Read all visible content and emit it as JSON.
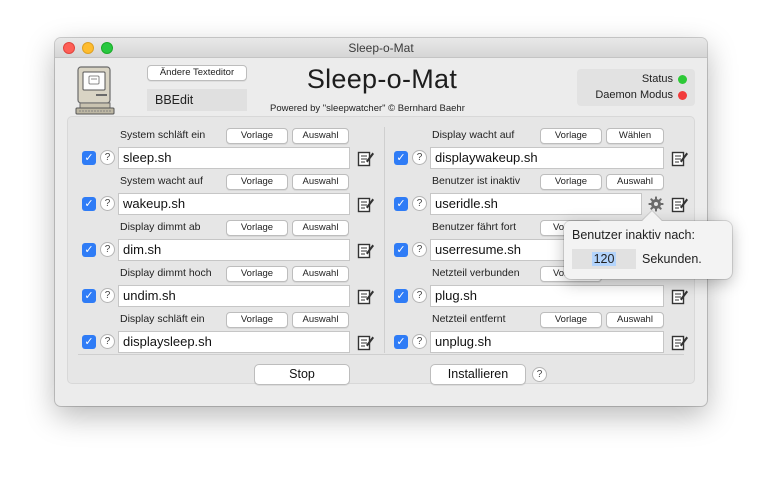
{
  "window": {
    "title": "Sleep-o-Mat"
  },
  "header": {
    "change_editor_label": "Ändere Texteditor",
    "editor_name": "BBEdit",
    "app_title": "Sleep-o-Mat",
    "subtitle": "Powered by \"sleepwatcher\" © Bernhard Baehr",
    "status_label": "Status",
    "status_color": "#2dc937",
    "daemon_label": "Daemon Modus",
    "daemon_color": "#f23b3b"
  },
  "rules_left": [
    {
      "label": "System schläft ein",
      "btn1": "Vorlage",
      "btn2": "Auswahl",
      "value": "sleep.sh",
      "checked": true
    },
    {
      "label": "System wacht auf",
      "btn1": "Vorlage",
      "btn2": "Auswahl",
      "value": "wakeup.sh",
      "checked": true
    },
    {
      "label": "Display dimmt ab",
      "btn1": "Vorlage",
      "btn2": "Auswahl",
      "value": "dim.sh",
      "checked": true
    },
    {
      "label": "Display dimmt hoch",
      "btn1": "Vorlage",
      "btn2": "Auswahl",
      "value": "undim.sh",
      "checked": true
    },
    {
      "label": "Display schläft ein",
      "btn1": "Vorlage",
      "btn2": "Auswahl",
      "value": "displaysleep.sh",
      "checked": true
    }
  ],
  "rules_right": [
    {
      "label": "Display wacht auf",
      "btn1": "Vorlage",
      "btn2": "Wählen",
      "value": "displaywakeup.sh",
      "checked": true
    },
    {
      "label": "Benutzer ist inaktiv",
      "btn1": "Vorlage",
      "btn2": "Auswahl",
      "value": "useridle.sh",
      "checked": true
    },
    {
      "label": "Benutzer fährt fort",
      "btn1": "Vor",
      "btn2": "",
      "value": "userresume.sh",
      "checked": true
    },
    {
      "label": "Netzteil verbunden",
      "btn1": "Vor",
      "btn2": "",
      "value": "plug.sh",
      "checked": true
    },
    {
      "label": "Netzteil entfernt",
      "btn1": "Vorlage",
      "btn2": "Auswahl",
      "value": "unplug.sh",
      "checked": true
    }
  ],
  "help_mark": "?",
  "check_mark": "✓",
  "footer": {
    "stop_label": "Stop",
    "install_label": "Installieren"
  },
  "popover": {
    "title": "Benutzer inaktiv nach:",
    "value": "120",
    "unit": "Sekunden."
  }
}
